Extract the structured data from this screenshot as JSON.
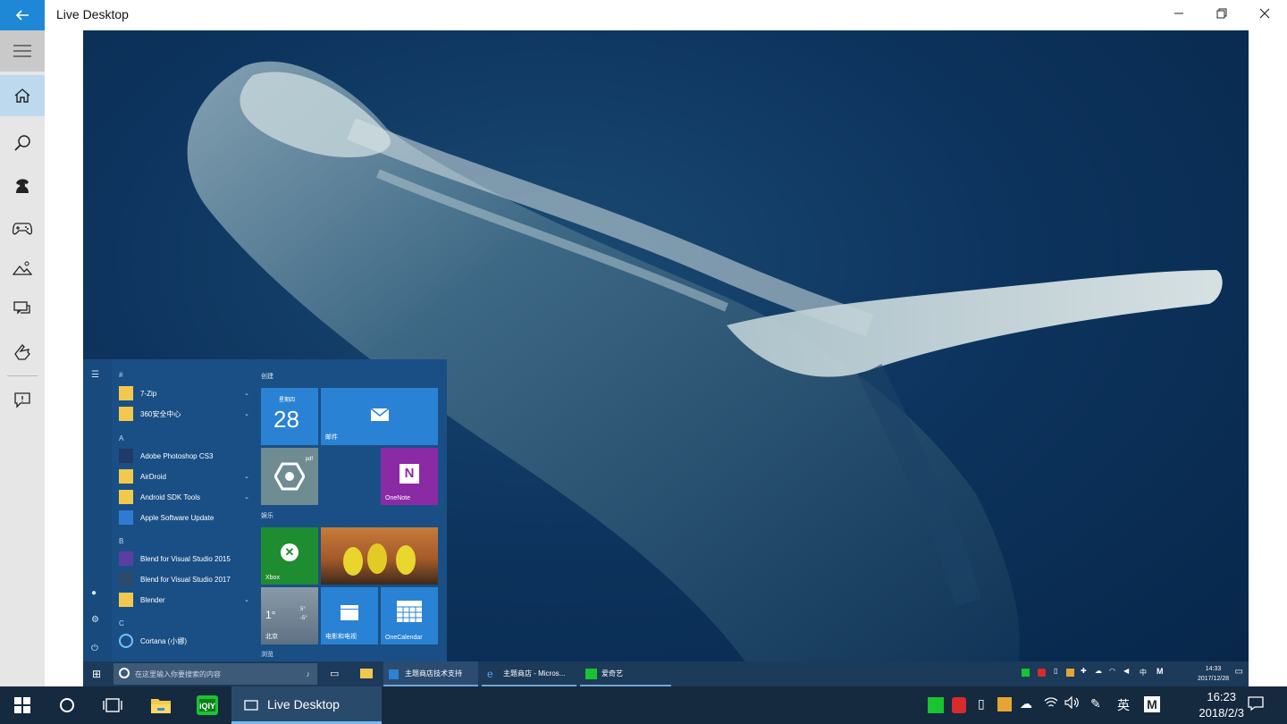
{
  "window": {
    "title": "Live Desktop",
    "back_icon": "arrow-left-icon",
    "controls": [
      "minimize-icon",
      "restore-icon",
      "close-icon"
    ]
  },
  "sidebar": {
    "items": [
      {
        "icon": "hamburger-icon"
      },
      {
        "icon": "home-icon",
        "active": true
      },
      {
        "icon": "search-icon"
      },
      {
        "icon": "agent-icon"
      },
      {
        "icon": "gamepad-icon"
      },
      {
        "icon": "landscape-icon"
      },
      {
        "icon": "chat-bubbles-icon"
      },
      {
        "icon": "hand-icon"
      },
      {
        "icon": "feedback-icon"
      }
    ]
  },
  "preview": {
    "start_menu": {
      "letters": [
        "#",
        "A",
        "B",
        "C"
      ],
      "apps": [
        {
          "label": "7-Zip",
          "expandable": true
        },
        {
          "label": "360安全中心",
          "expandable": true
        },
        {
          "label": "Adobe Photoshop CS3",
          "expandable": false
        },
        {
          "label": "AirDroid",
          "expandable": true
        },
        {
          "label": "Android SDK Tools",
          "expandable": true
        },
        {
          "label": "Apple Software Update",
          "expandable": false
        },
        {
          "label": "Blend for Visual Studio 2015",
          "expandable": false
        },
        {
          "label": "Blend for Visual Studio 2017",
          "expandable": false
        },
        {
          "label": "Blender",
          "expandable": true
        },
        {
          "label": "Cortana (小娜)",
          "expandable": false
        }
      ],
      "groups": [
        "创建",
        "娱乐",
        "浏览"
      ],
      "tiles": {
        "calendar_day": "星期四",
        "calendar_date": "28",
        "mail": "邮件",
        "onenote": "OneNote",
        "xbox": "Xbox",
        "weather_temp": "1°",
        "weather_hi": "5°",
        "weather_lo": "-5°",
        "weather_city": "北京",
        "movies": "电影和电视",
        "onecalendar": "OneCalendar",
        "app_tile_badge": "pdf"
      }
    },
    "inner_taskbar": {
      "search_placeholder": "在这里输入你要搜索的内容",
      "tasks": [
        "主题商店技术支持",
        "主题商店 - Micros...",
        "爱奇艺"
      ],
      "time": "14:33",
      "date": "2017/12/28",
      "ime": "中"
    }
  },
  "taskbar": {
    "active_app": "Live Desktop",
    "ime": "英",
    "time": "16:23",
    "date": "2018/2/3"
  }
}
